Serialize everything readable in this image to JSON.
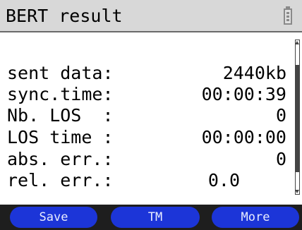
{
  "title": "BERT result",
  "rows": [
    {
      "label": "sent data:",
      "value": "2440kb"
    },
    {
      "label": "sync.time:",
      "value": "00:00:39"
    },
    {
      "label": "Nb. LOS  :",
      "value": "0"
    },
    {
      "label": "LOS time :",
      "value": "00:00:00"
    },
    {
      "label": "abs. err.:",
      "value": "0"
    },
    {
      "label": "rel. err.:",
      "value": "0.0"
    }
  ],
  "softkeys": {
    "left": "Save",
    "middle": "TM",
    "right": "More"
  },
  "icons": {
    "battery": "battery-icon",
    "scroll_up": "scroll-up-arrow-icon",
    "scroll_down": "scroll-down-arrow-icon"
  },
  "colors": {
    "title_bar": "#d8d8d8",
    "softkey_bg": "#1c35d8",
    "softkey_text": "#e8ecff",
    "softkey_bar": "#1e1e1e"
  }
}
